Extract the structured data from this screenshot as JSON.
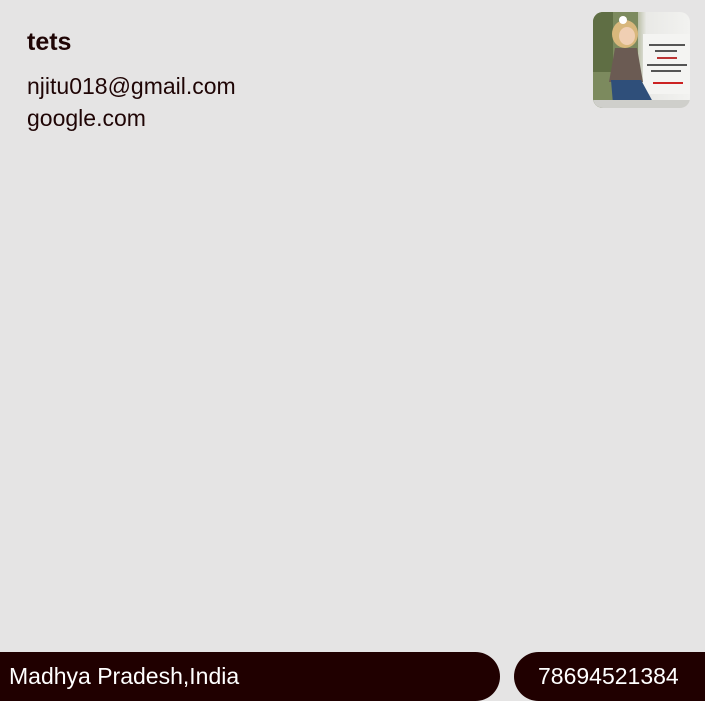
{
  "profile": {
    "name": "tets",
    "email": "njitu018@gmail.com",
    "website": "google.com"
  },
  "footer": {
    "location": "Madhya Pradesh,India",
    "phone": "78694521384"
  },
  "colors": {
    "background": "#e5e4e4",
    "text": "#1f0505",
    "footer_bg": "#200000",
    "footer_text": "#ffffff"
  }
}
